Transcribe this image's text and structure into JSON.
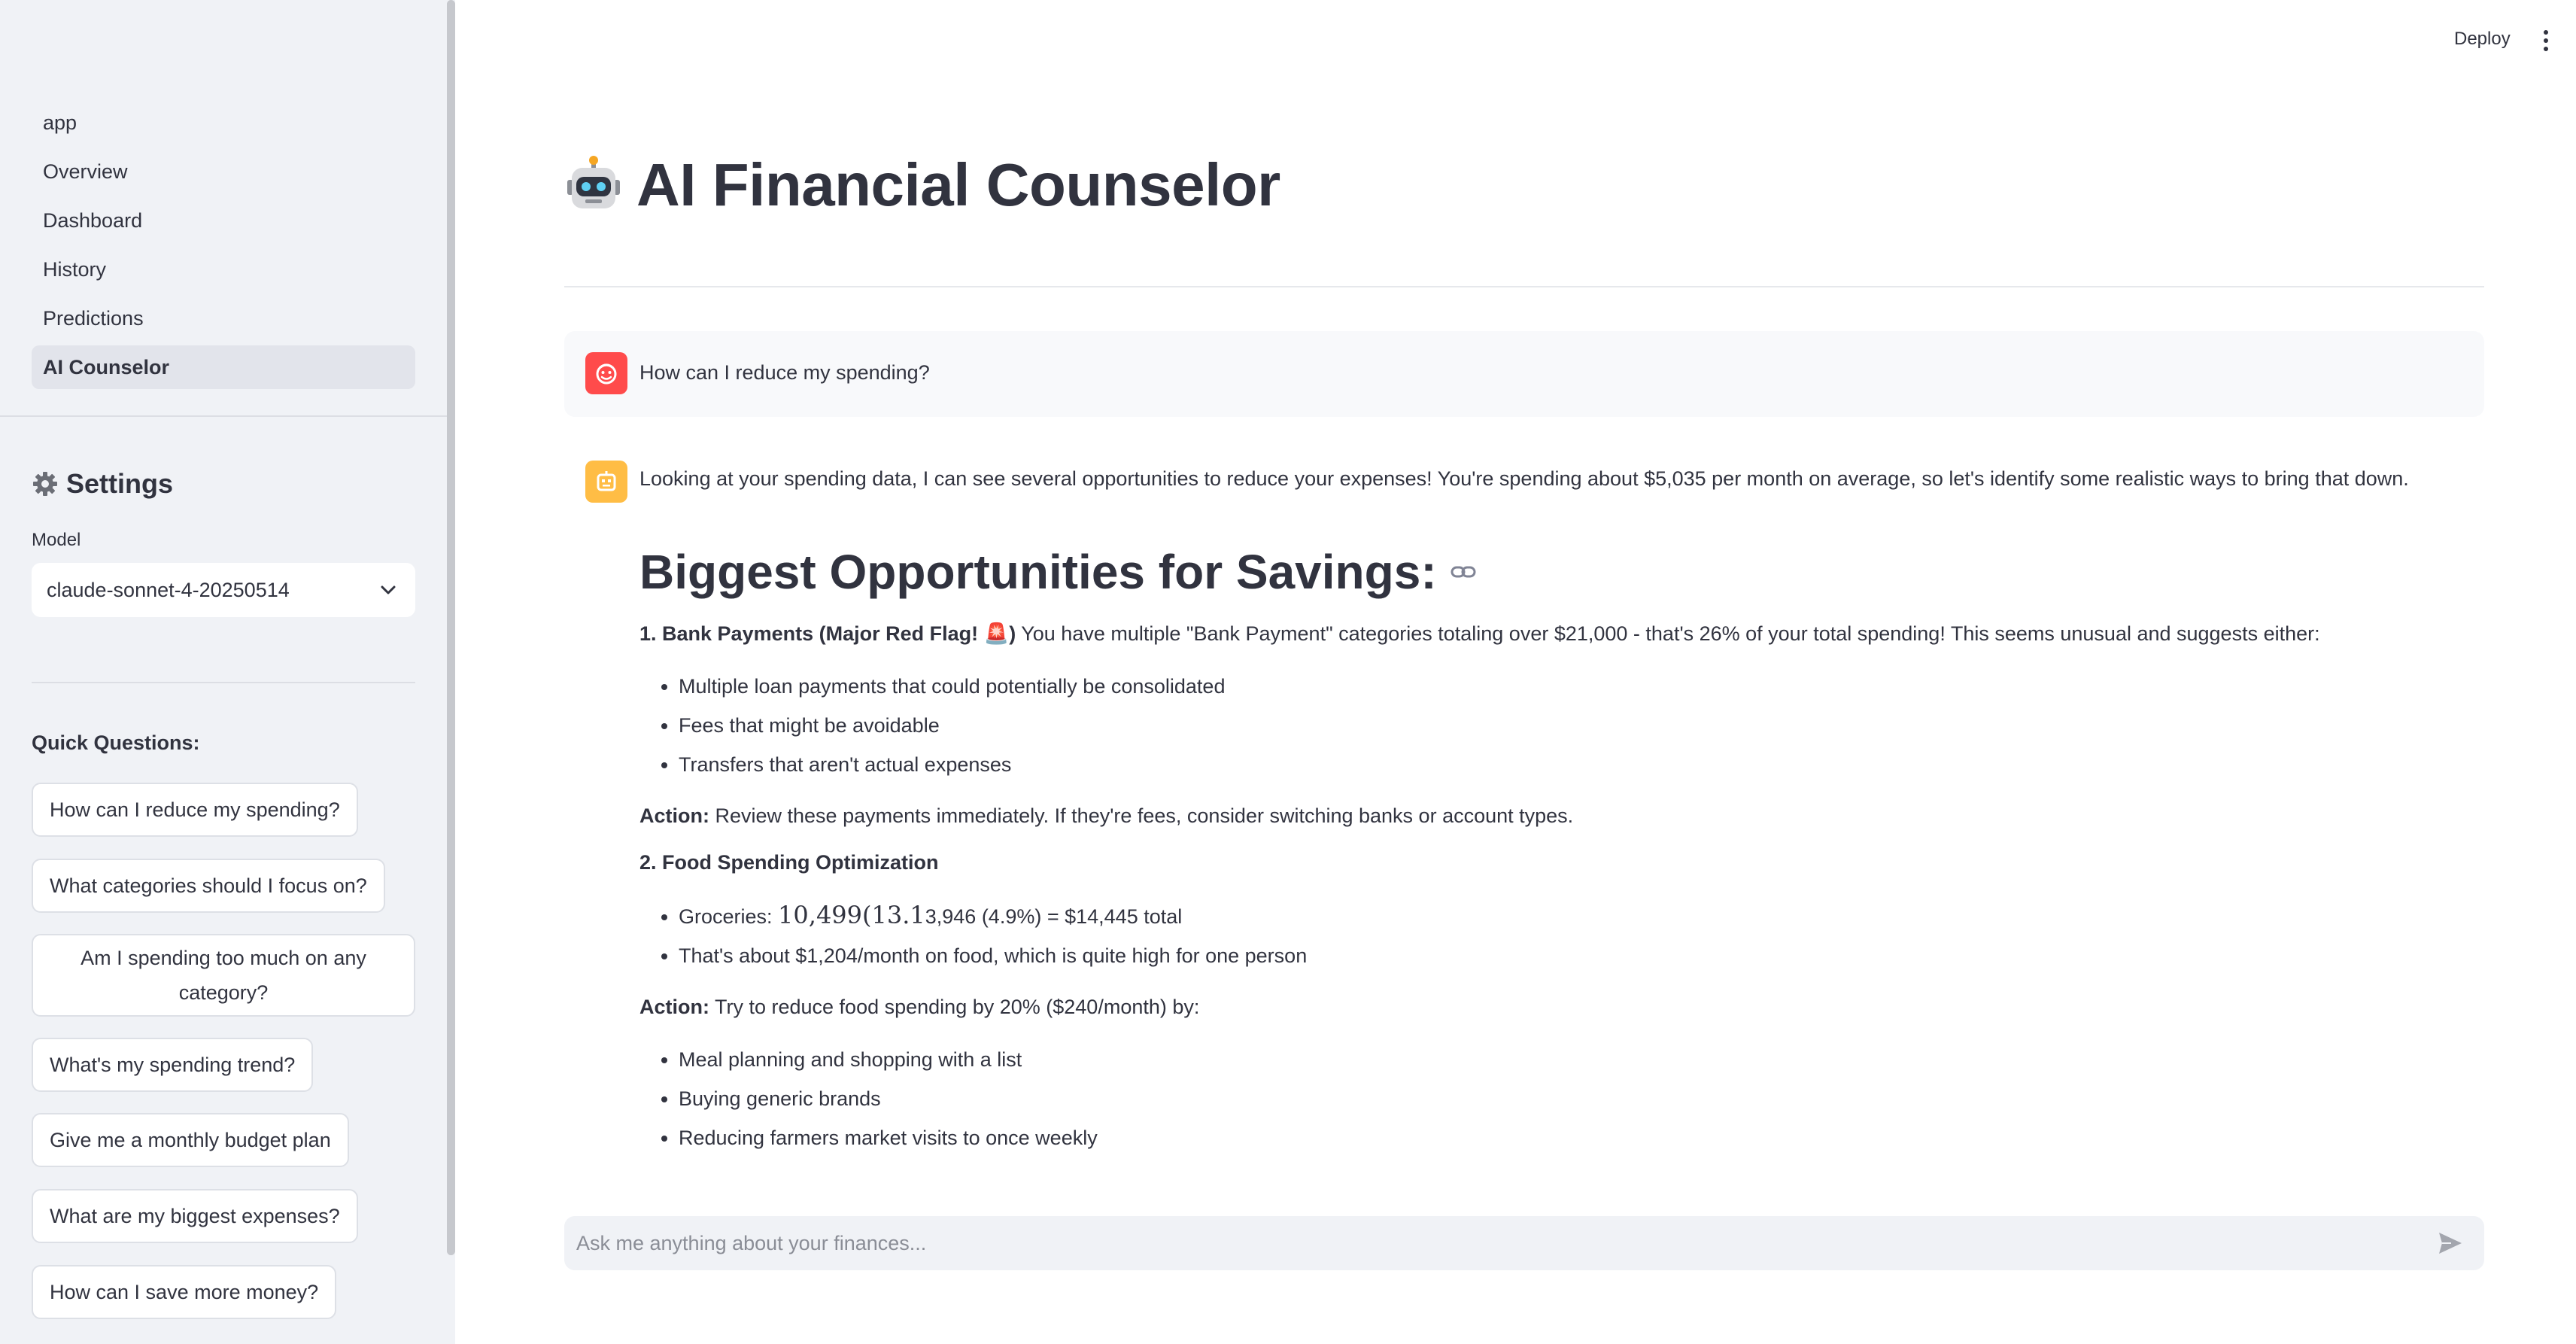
{
  "header": {
    "deploy_label": "Deploy"
  },
  "sidebar": {
    "nav": [
      "app",
      "Overview",
      "Dashboard",
      "History",
      "Predictions",
      "AI Counselor"
    ],
    "active_nav": "AI Counselor",
    "settings_title": "Settings",
    "model_label": "Model",
    "model_value": "claude-sonnet-4-20250514",
    "quick_questions_title": "Quick Questions:",
    "quick_questions": [
      "How can I reduce my spending?",
      "What categories should I focus on?",
      "Am I spending too much on any category?",
      "What's my spending trend?",
      "Give me a monthly budget plan",
      "What are my biggest expenses?",
      "How can I save more money?"
    ]
  },
  "main": {
    "title": "AI Financial Counselor",
    "user_message": "How can I reduce my spending?",
    "assistant": {
      "intro": "Looking at your spending data, I can see several opportunities to reduce your expenses! You're spending about $5,035 per month on average, so let's identify some realistic ways to bring that down.",
      "heading": "Biggest Opportunities for Savings:",
      "section1_title": "1. Bank Payments (Major Red Flag! 🚨)",
      "section1_text": " You have multiple \"Bank Payment\" categories totaling over $21,000 - that's 26% of your total spending! This seems unusual and suggests either:",
      "section1_bullets": [
        "Multiple loan payments that could potentially be consolidated",
        "Fees that might be avoidable",
        "Transfers that aren't actual expenses"
      ],
      "action_label": "Action:",
      "action1_text": " Review these payments immediately. If they're fees, consider switching banks or account types.",
      "section2_title": "2. Food Spending Optimization",
      "groceries_prefix": "Groceries: ",
      "groceries_math": "10,499(13.1",
      "groceries_suffix": "3,946 (4.9%) = $14,445 total",
      "food_bullet2": "That's about $1,204/month on food, which is quite high for one person",
      "action2_text": " Try to reduce food spending by 20% ($240/month) by:",
      "section2_bullets": [
        "Meal planning and shopping with a list",
        "Buying generic brands",
        "Reducing farmers market visits to once weekly"
      ]
    },
    "chat_placeholder": "Ask me anything about your finances..."
  }
}
